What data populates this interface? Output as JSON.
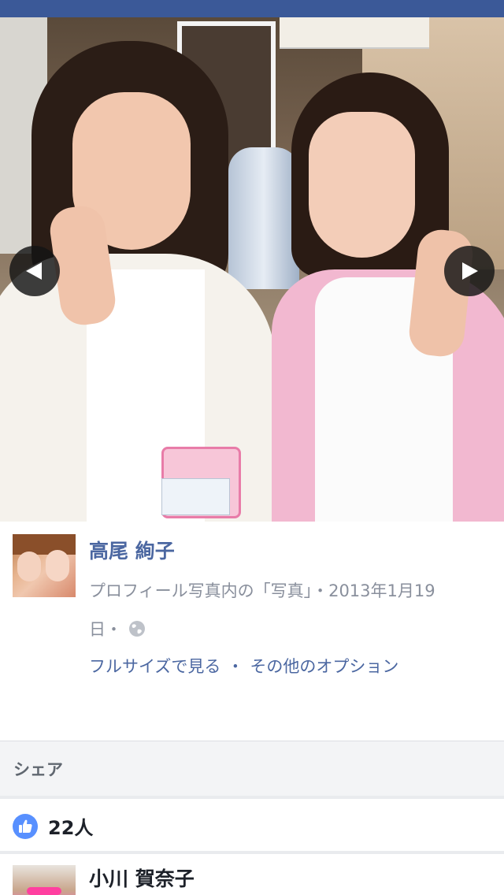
{
  "post": {
    "author": "高尾 絢子",
    "meta_line1": "プロフィール写真内の「写真」・2013年1月19",
    "meta_line2": "日・",
    "option_full_size": "フルサイズで見る",
    "option_separator": "・",
    "option_more": "その他のオプション"
  },
  "photo": {
    "prev_icon": "chevron-left-icon",
    "next_icon": "chevron-right-icon"
  },
  "share": {
    "label": "シェア"
  },
  "reactions": {
    "like_count": "22人",
    "icon": "thumbs-up-icon",
    "color": "#5890ff"
  },
  "comment": {
    "author": "小川 賀奈子"
  },
  "colors": {
    "topbar": "#3b5998",
    "link": "#4b67a1",
    "meta": "#898f9c"
  }
}
